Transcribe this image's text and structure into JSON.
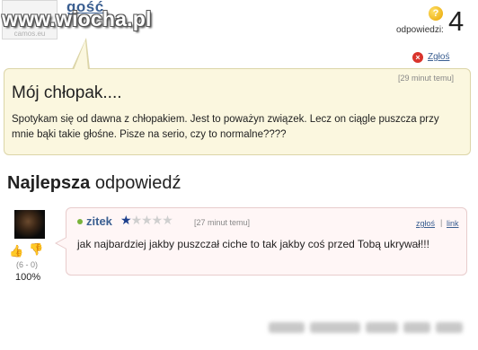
{
  "header": {
    "avatar_text": "camos.eu",
    "username": "gość",
    "watermark": "www.wiocha.pl",
    "answers_label": "odpowiedzi:",
    "answers_count": "4",
    "question_icon": "?"
  },
  "question": {
    "report_label": "Zgłoś",
    "time": "[29 minut temu]",
    "title": "Mój chłopak....",
    "body": "Spotykam się od dawna z chłopakiem. Jest to poważyn związek. Lecz on ciągle puszcza przy mnie bąki takie głośne. Pisze na serio, czy to normalne????"
  },
  "best_answer": {
    "heading_bold": "Najlepsza",
    "heading_rest": " odpowiedź",
    "username": "zitek",
    "stars_on": "★",
    "stars_off": "★★★★",
    "time": "[27 minut temu]",
    "report_label": "zgłoś",
    "separator": "|",
    "link_label": "link",
    "body": "jak najbardziej jakby puszczał ciche to tak jakby coś przed Tobą ukrywał!!!",
    "votes": "(6 - 0)",
    "percent": "100%"
  },
  "colors": {
    "link": "#3b5f91",
    "question_bg": "#fbf7df",
    "answer_bg": "#fff6f6",
    "star_on": "#1d3f8c"
  }
}
